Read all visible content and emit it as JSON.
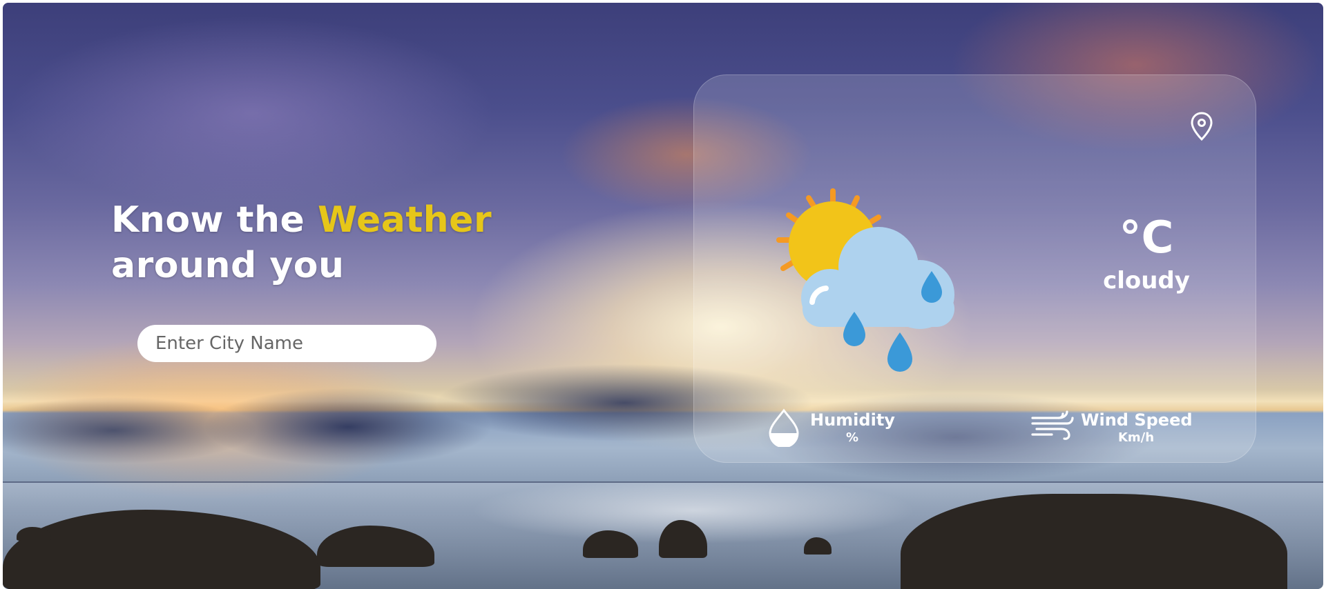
{
  "hero": {
    "headline_part1": "Know the ",
    "headline_accent": "Weather",
    "headline_part2": "around you",
    "accent_color": "#e6c619"
  },
  "search": {
    "placeholder": "Enter City Name",
    "value": ""
  },
  "card": {
    "location_icon": "location-pin-icon",
    "weather_icon": "sun-cloud-rain-icon",
    "temperature": "°C",
    "condition": "cloudy",
    "humidity": {
      "icon": "droplet-icon",
      "label": "Humidity",
      "unit": "%"
    },
    "wind": {
      "icon": "wind-icon",
      "label": "Wind Speed",
      "unit": "Km/h"
    }
  },
  "colors": {
    "sun": "#f2c419",
    "sun_rays": "#f59a23",
    "cloud": "#aed2ee",
    "rain_drop": "#3b99d8"
  }
}
